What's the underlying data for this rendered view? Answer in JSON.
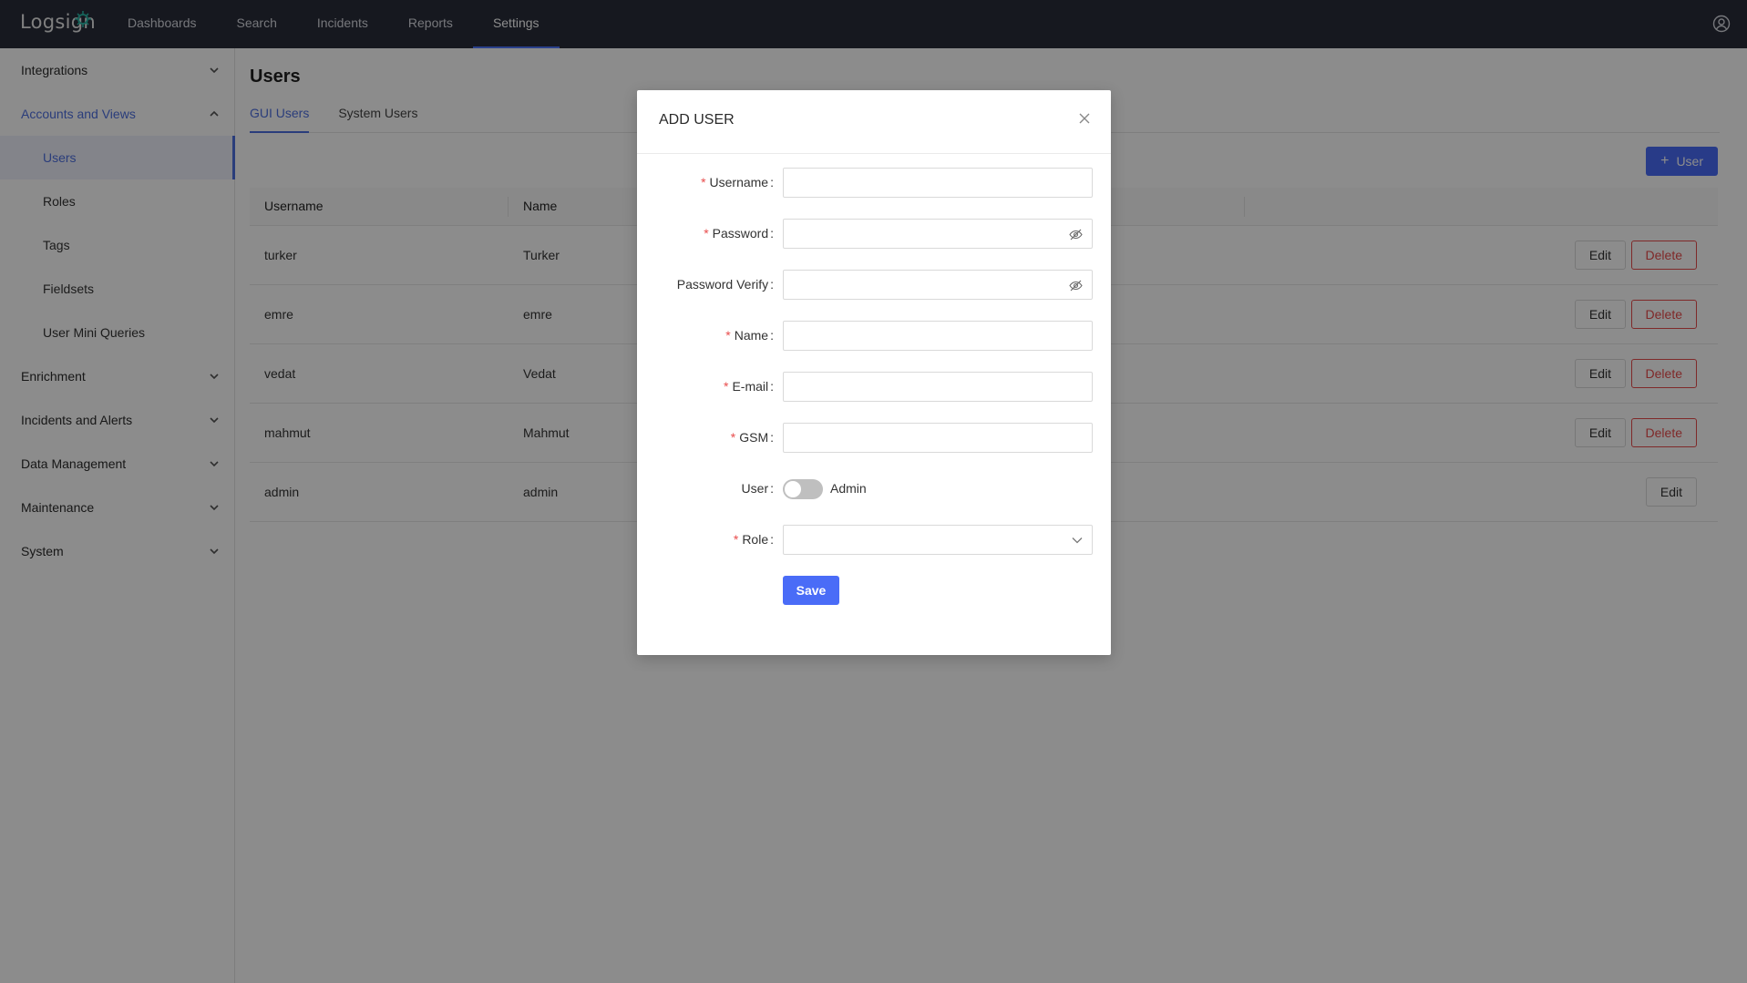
{
  "app": {
    "logo": "Logsign"
  },
  "nav": {
    "items": [
      {
        "label": "Dashboards"
      },
      {
        "label": "Search"
      },
      {
        "label": "Incidents"
      },
      {
        "label": "Reports"
      },
      {
        "label": "Settings"
      }
    ],
    "active": "Settings"
  },
  "sidebar": {
    "items": [
      {
        "label": "Integrations"
      },
      {
        "label": "Accounts and Views"
      },
      {
        "label": "Enrichment"
      },
      {
        "label": "Incidents and Alerts"
      },
      {
        "label": "Data Management"
      },
      {
        "label": "Maintenance"
      },
      {
        "label": "System"
      }
    ],
    "subitems": [
      {
        "label": "Users"
      },
      {
        "label": "Roles"
      },
      {
        "label": "Tags"
      },
      {
        "label": "Fieldsets"
      },
      {
        "label": "User Mini Queries"
      }
    ]
  },
  "page": {
    "title": "Users",
    "tabs": [
      {
        "label": "GUI Users"
      },
      {
        "label": "System Users"
      }
    ],
    "add_button": "User"
  },
  "table": {
    "headers": {
      "username": "Username",
      "name": "Name"
    },
    "rows": [
      {
        "username": "turker",
        "name": "Turker",
        "edit": "Edit",
        "delete": "Delete"
      },
      {
        "username": "emre",
        "name": "emre",
        "edit": "Edit",
        "delete": "Delete"
      },
      {
        "username": "vedat",
        "name": "Vedat",
        "edit": "Edit",
        "delete": "Delete"
      },
      {
        "username": "mahmut",
        "name": "Mahmut",
        "edit": "Edit",
        "delete": "Delete"
      },
      {
        "username": "admin",
        "name": "admin",
        "edit": "Edit"
      }
    ]
  },
  "modal": {
    "title": "ADD USER",
    "fields": {
      "username": {
        "label": "Username",
        "value": ""
      },
      "password": {
        "label": "Password",
        "value": ""
      },
      "password_verify": {
        "label": "Password Verify",
        "value": ""
      },
      "name": {
        "label": "Name",
        "value": ""
      },
      "email": {
        "label": "E-mail",
        "value": ""
      },
      "gsm": {
        "label": "GSM",
        "value": ""
      },
      "user_type": {
        "label": "User",
        "toggle_label": "Admin",
        "checked": false
      },
      "role": {
        "label": "Role",
        "value": ""
      }
    },
    "save_label": "Save"
  },
  "colors": {
    "accent": "#4a6cf7",
    "danger": "#e84c4c",
    "topbar": "#282c3a"
  },
  "icons": [
    "logo-leaf-icon",
    "user-circle-icon",
    "chevron-down-icon",
    "chevron-up-icon",
    "plus-icon",
    "close-icon",
    "eye-invisible-icon",
    "select-arrow-icon"
  ]
}
